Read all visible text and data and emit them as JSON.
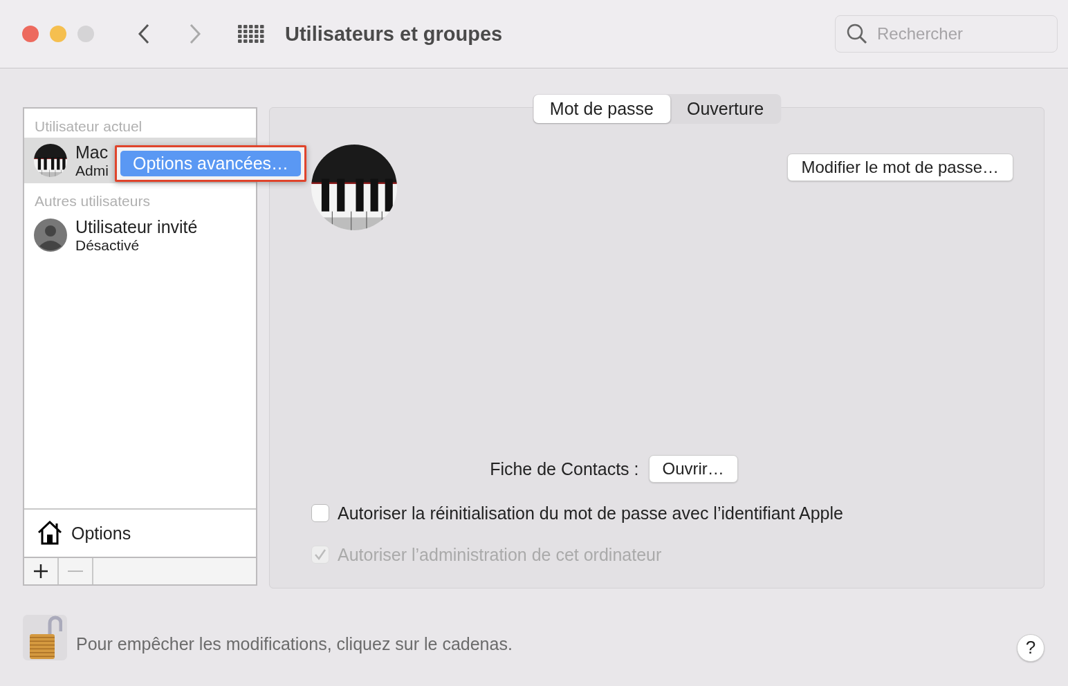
{
  "window": {
    "title": "Utilisateurs et groupes"
  },
  "search": {
    "placeholder": "Rechercher"
  },
  "sidebar": {
    "sections": [
      {
        "heading": "Utilisateur actuel",
        "users": [
          {
            "name": "Mac",
            "role": "Admi",
            "selected": true,
            "kind": "picture"
          }
        ]
      },
      {
        "heading": "Autres utilisateurs",
        "users": [
          {
            "name": "Utilisateur invité",
            "role": "Désactivé",
            "selected": false,
            "kind": "silhouette"
          }
        ]
      }
    ],
    "options_label": "Options",
    "add_disabled": false,
    "remove_disabled": true
  },
  "context_menu": {
    "annotated": true,
    "items": [
      {
        "label": "Options avancées…",
        "selected": true
      }
    ]
  },
  "tabs": [
    {
      "label": "Mot de passe",
      "selected": true
    },
    {
      "label": "Ouverture",
      "selected": false
    }
  ],
  "password_button": "Modifier le mot de passe…",
  "contacts": {
    "label": "Fiche de Contacts :",
    "button": "Ouvrir…"
  },
  "checkboxes": [
    {
      "label": "Autoriser la réinitialisation du mot de passe avec l’identifiant Apple",
      "checked": false,
      "disabled": false
    },
    {
      "label": "Autoriser l’administration de cet ordinateur",
      "checked": true,
      "disabled": true
    }
  ],
  "footer": {
    "lock_open": true,
    "message": "Pour empêcher les modifications, cliquez sur le cadenas.",
    "help": "?"
  }
}
